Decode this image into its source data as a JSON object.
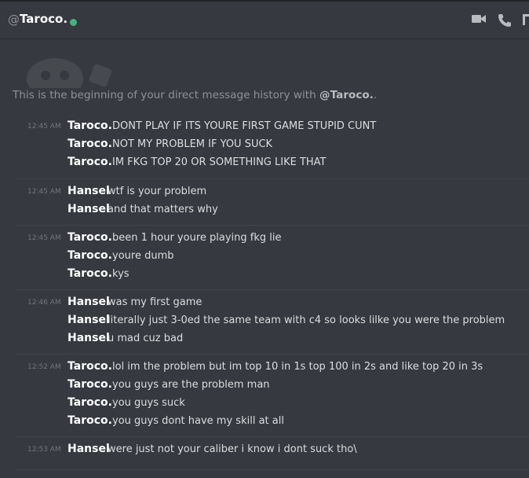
{
  "header": {
    "at_symbol": "@",
    "title": "Taroco.",
    "status_color": "#43b581",
    "icons": [
      "video-call-icon",
      "phone-call-icon",
      "pin-icon"
    ]
  },
  "intro": {
    "prefix": "This is the beginning of your direct message history with ",
    "user": "@Taroco.",
    "suffix": "."
  },
  "groups": [
    {
      "time": "12:45 AM",
      "messages": [
        {
          "author": "Taroco.",
          "text": "DONT PLAY IF ITS YOURE FIRST GAME STUPID CUNT"
        },
        {
          "author": "Taroco.",
          "text": "NOT MY PROBLEM IF YOU SUCK"
        },
        {
          "author": "Taroco.",
          "text": "IM FKG TOP 20 OR SOMETHING LIKE THAT"
        }
      ]
    },
    {
      "time": "12:45 AM",
      "messages": [
        {
          "author": "Hansel",
          "text": "wtf is your problem"
        },
        {
          "author": "Hansel",
          "text": "and that matters why"
        }
      ]
    },
    {
      "time": "12:45 AM",
      "messages": [
        {
          "author": "Taroco.",
          "text": "been 1 hour youre playing fkg lie"
        },
        {
          "author": "Taroco.",
          "text": "youre dumb"
        },
        {
          "author": "Taroco.",
          "text": "kys"
        }
      ]
    },
    {
      "time": "12:46 AM",
      "messages": [
        {
          "author": "Hansel",
          "text": "was my first game"
        },
        {
          "author": "Hansel",
          "text": "literally just 3-0ed the same team with c4 so looks lilke you were the problem"
        },
        {
          "author": "Hansel",
          "text": "u mad cuz bad"
        }
      ]
    },
    {
      "time": "12:52 AM",
      "messages": [
        {
          "author": "Taroco.",
          "text": "lol im the problem but im top 10 in 1s top 100 in 2s and like top 20 in 3s"
        },
        {
          "author": "Taroco.",
          "text": "you guys are the problem man"
        },
        {
          "author": "Taroco.",
          "text": "you guys suck"
        },
        {
          "author": "Taroco.",
          "text": "you guys dont have  my skill at all"
        }
      ]
    },
    {
      "time": "12:53 AM",
      "messages": [
        {
          "author": "Hansel",
          "text": "were just not your caliber i know i dont suck tho\\"
        }
      ]
    }
  ]
}
